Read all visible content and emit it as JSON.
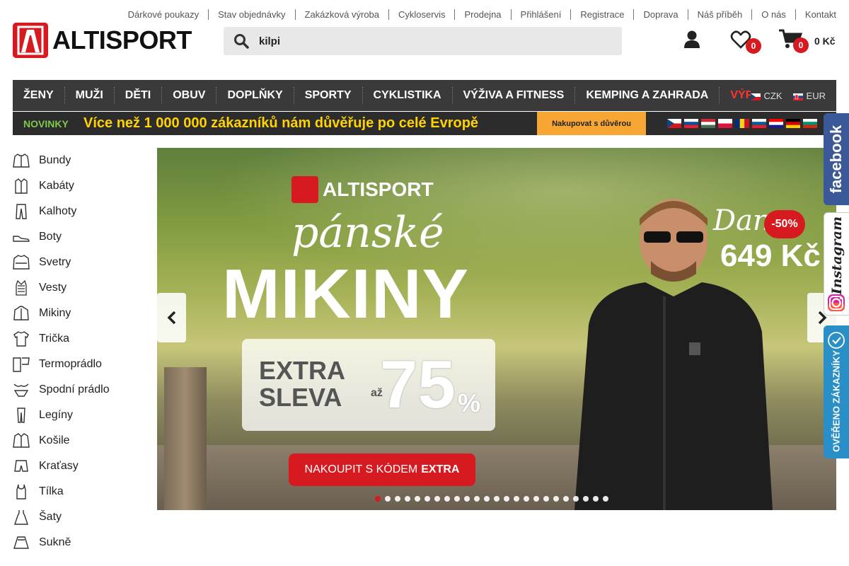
{
  "top_links": [
    "Dárkové poukazy",
    "Stav objednávky",
    "Zakázková výroba",
    "Cykloservis",
    "Prodejna",
    "Přihlášení",
    "Registrace",
    "Doprava",
    "Náš příběh",
    "O nás",
    "Kontakt"
  ],
  "logo": {
    "text": "ALTISPORT"
  },
  "search": {
    "value": "kilpi"
  },
  "header": {
    "wishlist_count": "0",
    "cart_count": "0",
    "cart_total": "0 Kč"
  },
  "nav": {
    "items": [
      "ŽENY",
      "MUŽI",
      "DĚTI",
      "OBUV",
      "DOPLŇKY",
      "SPORTY",
      "CYKLISTIKA",
      "VÝŽIVA A FITNESS",
      "KEMPING A ZAHRADA",
      "VÝPRODEJ"
    ],
    "currencies": [
      "CZK",
      "EUR"
    ]
  },
  "trust_banner": {
    "label": "NOVINKY",
    "headline": "Více než 1 000 000 zákazníků nám důvěřuje po celé Evropě",
    "cta": "Nakupovat s důvěrou"
  },
  "categories": [
    {
      "label": "Bundy",
      "icon": "jacket-icon"
    },
    {
      "label": "Kabáty",
      "icon": "coat-icon"
    },
    {
      "label": "Kalhoty",
      "icon": "trousers-icon"
    },
    {
      "label": "Boty",
      "icon": "shoe-icon"
    },
    {
      "label": "Svetry",
      "icon": "sweater-icon"
    },
    {
      "label": "Vesty",
      "icon": "vest-icon"
    },
    {
      "label": "Mikiny",
      "icon": "hoodie-icon"
    },
    {
      "label": "Trička",
      "icon": "tshirt-icon"
    },
    {
      "label": "Termoprádlo",
      "icon": "thermal-underwear-icon"
    },
    {
      "label": "Spodní prádlo",
      "icon": "underwear-icon"
    },
    {
      "label": "Legíny",
      "icon": "leggings-icon"
    },
    {
      "label": "Košile",
      "icon": "shirt-icon"
    },
    {
      "label": "Kraťasy",
      "icon": "shorts-icon"
    },
    {
      "label": "Tílka",
      "icon": "tanktop-icon"
    },
    {
      "label": "Šaty",
      "icon": "dress-icon"
    },
    {
      "label": "Sukně",
      "icon": "skirt-icon"
    }
  ],
  "hero": {
    "brand": "ALTISPORT",
    "script_line": "pánské",
    "title": "MIKINY",
    "extra_line1": "EXTRA",
    "extra_line2": "SLEVA",
    "az": "až",
    "percent_value": "75",
    "percent_sign": "%",
    "cta_prefix": "NAKOUPIT S KÓDEM",
    "cta_code": "EXTRA",
    "price_prefix": "Dan",
    "discount": "-50%",
    "price": "649 Kč",
    "slides_total": 24,
    "active_slide": 1
  },
  "side_tabs": {
    "facebook": "facebook",
    "instagram": "Instagram",
    "verified": "OVĚŘENO ZÁKAZNÍKY"
  },
  "colors": {
    "brand_red": "#d71920",
    "nav_bg": "#3a3a3a",
    "trust_yellow": "#ffd200",
    "facebook_blue": "#3b5998",
    "verified_blue": "#2a8fc7"
  }
}
